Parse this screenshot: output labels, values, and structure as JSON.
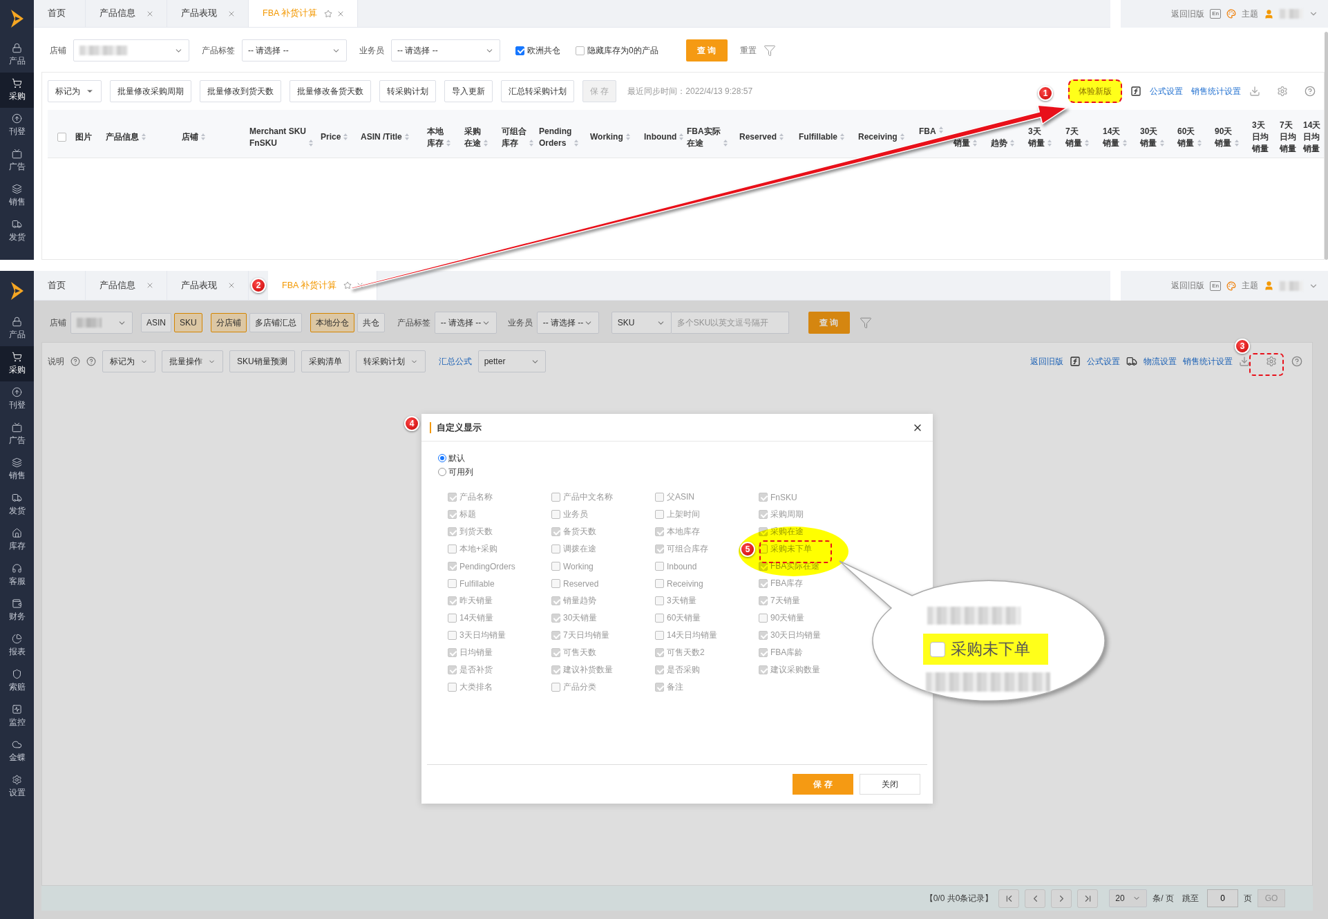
{
  "top_screen": {
    "sidebar": [
      {
        "label": "产品",
        "selected": false
      },
      {
        "label": "采购",
        "selected": true
      },
      {
        "label": "刊登",
        "selected": false
      },
      {
        "label": "广告",
        "selected": false
      },
      {
        "label": "销售",
        "selected": false
      },
      {
        "label": "发货",
        "selected": false
      }
    ],
    "tabs": [
      {
        "label": "首页",
        "closable": false,
        "star": false,
        "selected": false
      },
      {
        "label": "产品信息",
        "closable": true,
        "star": false,
        "selected": false
      },
      {
        "label": "产品表现",
        "closable": true,
        "star": false,
        "selected": false
      },
      {
        "label": "FBA 补货计算",
        "closable": true,
        "star": true,
        "selected": true
      }
    ],
    "header": {
      "old_version": "返回旧版",
      "language": "En",
      "theme": "主题"
    },
    "filters": {
      "shop_label": "店铺",
      "tag_label": "产品标签",
      "tag_value": "-- 请选择 --",
      "staff_label": "业务员",
      "staff_value": "-- 请选择 --",
      "options": [
        {
          "label": "欧洲共仓",
          "checked": true
        },
        {
          "label": "隐藏库存为0的产品",
          "checked": false
        }
      ],
      "query": "查 询",
      "reset": "重置"
    },
    "toolbar": {
      "buttons": [
        {
          "label": "标记为",
          "kind": "dropdown",
          "disabled": false
        },
        {
          "label": "批量修改采购周期",
          "kind": "button",
          "disabled": false
        },
        {
          "label": "批量修改到货天数",
          "kind": "button",
          "disabled": false
        },
        {
          "label": "批量修改备货天数",
          "kind": "button",
          "disabled": false
        },
        {
          "label": "转采购计划",
          "kind": "button",
          "disabled": false
        },
        {
          "label": "导入更新",
          "kind": "button",
          "disabled": false
        },
        {
          "label": "汇总转采购计划",
          "kind": "button",
          "disabled": false
        },
        {
          "label": "保 存",
          "kind": "button",
          "disabled": true
        }
      ],
      "sync_time": "最近同步时间：2022/4/13 9:28:57",
      "try_new": "体验新版",
      "links": [
        {
          "label": "公式设置",
          "kind": "formula"
        },
        {
          "label": "销售统计设置",
          "kind": "plain"
        }
      ]
    },
    "table": {
      "select_all": {
        "checked": false
      },
      "columns": [
        {
          "lines": [
            "图片"
          ],
          "sortable": false
        },
        {
          "lines": [
            "产品信息"
          ],
          "sortable": true
        },
        {
          "lines": [
            "店铺"
          ],
          "sortable": true
        },
        {
          "lines": [
            "Merchant SKU",
            "FnSKU"
          ],
          "sortable": true
        },
        {
          "lines": [
            "Price"
          ],
          "sortable": true
        },
        {
          "lines": [
            "ASIN /Title"
          ],
          "sortable": true
        },
        {
          "lines": [
            "本地",
            "库存"
          ],
          "sortable": true
        },
        {
          "lines": [
            "采购",
            "在途"
          ],
          "sortable": true
        },
        {
          "lines": [
            "可组合",
            "库存"
          ],
          "sortable": true
        },
        {
          "lines": [
            "Pending",
            "Orders"
          ],
          "sortable": true
        },
        {
          "lines": [
            "Working"
          ],
          "sortable": true
        },
        {
          "lines": [
            "Inbound"
          ],
          "sortable": true
        },
        {
          "lines": [
            "FBA实际",
            "在途"
          ],
          "sortable": true
        },
        {
          "lines": [
            "Reserved"
          ],
          "sortable": true
        },
        {
          "lines": [
            "Fulfillable"
          ],
          "sortable": true
        },
        {
          "lines": [
            "Receiving"
          ],
          "sortable": true
        },
        {
          "lines": [
            "FBA"
          ],
          "bottom_covered": true,
          "sortable": true
        },
        {
          "lines": [
            "销量"
          ],
          "top_covered": true,
          "sortable": true
        },
        {
          "lines": [
            "趋势"
          ],
          "top_covered": true,
          "sortable": true
        },
        {
          "lines": [
            "3天",
            "销量"
          ],
          "sortable": true
        },
        {
          "lines": [
            "7天",
            "销量"
          ],
          "sortable": true
        },
        {
          "lines": [
            "14天",
            "销量"
          ],
          "sortable": true
        },
        {
          "lines": [
            "30天",
            "销量"
          ],
          "sortable": true
        },
        {
          "lines": [
            "60天",
            "销量"
          ],
          "sortable": true
        },
        {
          "lines": [
            "90天",
            "销量"
          ],
          "sortable": true
        },
        {
          "lines": [
            "3天",
            "日均",
            "销量"
          ],
          "sortable": false
        },
        {
          "lines": [
            "7天",
            "日均",
            "销量"
          ],
          "sortable": false
        },
        {
          "lines": [
            "14天",
            "日均",
            "销量"
          ],
          "sortable": false
        }
      ]
    }
  },
  "bottom_screen": {
    "sidebar": [
      {
        "label": "产品",
        "selected": false
      },
      {
        "label": "采购",
        "selected": true
      },
      {
        "label": "刊登",
        "selected": false
      },
      {
        "label": "广告",
        "selected": false
      },
      {
        "label": "销售",
        "selected": false
      },
      {
        "label": "发货",
        "selected": false
      },
      {
        "label": "库存",
        "selected": false
      },
      {
        "label": "客服",
        "selected": false
      },
      {
        "label": "财务",
        "selected": false
      },
      {
        "label": "报表",
        "selected": false
      },
      {
        "label": "索赔",
        "selected": false
      },
      {
        "label": "监控",
        "selected": false
      },
      {
        "label": "金蝶",
        "selected": false
      },
      {
        "label": "设置",
        "selected": false
      }
    ],
    "tabs": [
      {
        "label": "首页",
        "closable": false,
        "star": false,
        "selected": false
      },
      {
        "label": "产品信息",
        "closable": true,
        "star": false,
        "selected": false
      },
      {
        "label": "产品表现",
        "closable": true,
        "star": false,
        "selected": false
      },
      {
        "label": "FBA 补货计算",
        "closable": true,
        "star": true,
        "selected": true
      }
    ],
    "header": {
      "old_version": "返回旧版",
      "language": "En",
      "theme": "主题"
    },
    "filters": {
      "shop_label": "店铺",
      "toggle_groups": [
        [
          {
            "label": "ASIN",
            "selected": false
          },
          {
            "label": "SKU",
            "selected": true
          }
        ],
        [
          {
            "label": "分店铺",
            "selected": true
          },
          {
            "label": "多店铺汇总",
            "selected": false
          }
        ],
        [
          {
            "label": "本地分仓",
            "selected": true
          },
          {
            "label": "共仓",
            "selected": false
          }
        ]
      ],
      "tag_label": "产品标签",
      "tag_value": "-- 请选择 --",
      "staff_label": "业务员",
      "staff_value": "-- 请选择 --",
      "search_type": "SKU",
      "search_placeholder": "多个SKU以英文逗号隔开",
      "query": "查 询"
    },
    "toolbar": {
      "help_label": "说明",
      "buttons": [
        {
          "label": "标记为",
          "kind": "dropdown"
        },
        {
          "label": "批量操作",
          "kind": "dropdown"
        },
        {
          "label": "SKU销量预测",
          "kind": "button"
        },
        {
          "label": "采购清单",
          "kind": "button"
        },
        {
          "label": "转采购计划",
          "kind": "dropdown"
        }
      ],
      "formula_label": "汇总公式",
      "formula_value": "petter",
      "links": [
        {
          "label": "返回旧版",
          "kind": "plain"
        },
        {
          "label": "公式设置",
          "kind": "formula"
        },
        {
          "label": "物流设置",
          "kind": "truck"
        },
        {
          "label": "销售统计设置",
          "kind": "plain"
        }
      ]
    },
    "dialog": {
      "title": "自定义显示",
      "modes": [
        {
          "label": "默认",
          "selected": true
        },
        {
          "label": "可用列",
          "selected": false
        }
      ],
      "options_disabled": true,
      "columns": [
        {
          "label": "产品名称",
          "checked": true
        },
        {
          "label": "产品中文名称",
          "checked": false
        },
        {
          "label": "父ASIN",
          "checked": false
        },
        {
          "label": "FnSKU",
          "checked": true
        },
        {
          "label": "标题",
          "checked": true
        },
        {
          "label": "业务员",
          "checked": false
        },
        {
          "label": "上架时间",
          "checked": false
        },
        {
          "label": "采购周期",
          "checked": true
        },
        {
          "label": "到货天数",
          "checked": true
        },
        {
          "label": "备货天数",
          "checked": true
        },
        {
          "label": "本地库存",
          "checked": true
        },
        {
          "label": "采购在途",
          "checked": true
        },
        {
          "label": "本地+采购",
          "checked": false
        },
        {
          "label": "调拨在途",
          "checked": false
        },
        {
          "label": "可组合库存",
          "checked": true
        },
        {
          "label": "采购未下单",
          "checked": false
        },
        {
          "label": "PendingOrders",
          "checked": true
        },
        {
          "label": "Working",
          "checked": false
        },
        {
          "label": "Inbound",
          "checked": false
        },
        {
          "label": "FBA实际在途",
          "checked": true
        },
        {
          "label": "Fulfillable",
          "checked": false
        },
        {
          "label": "Reserved",
          "checked": false
        },
        {
          "label": "Receiving",
          "checked": false
        },
        {
          "label": "FBA库存",
          "checked": true
        },
        {
          "label": "昨天销量",
          "checked": true
        },
        {
          "label": "销量趋势",
          "checked": true
        },
        {
          "label": "3天销量",
          "checked": false
        },
        {
          "label": "7天销量",
          "checked": true
        },
        {
          "label": "14天销量",
          "checked": false
        },
        {
          "label": "30天销量",
          "checked": true
        },
        {
          "label": "60天销量",
          "checked": false
        },
        {
          "label": "90天销量",
          "checked": false
        },
        {
          "label": "3天日均销量",
          "checked": false
        },
        {
          "label": "7天日均销量",
          "checked": true
        },
        {
          "label": "14天日均销量",
          "checked": false
        },
        {
          "label": "30天日均销量",
          "checked": true
        },
        {
          "label": "日均销量",
          "checked": true
        },
        {
          "label": "可售天数",
          "checked": true
        },
        {
          "label": "可售天数2",
          "checked": true
        },
        {
          "label": "FBA库龄",
          "checked": true
        },
        {
          "label": "是否补货",
          "checked": true
        },
        {
          "label": "建议补货数量",
          "checked": true
        },
        {
          "label": "是否采购",
          "checked": true
        },
        {
          "label": "建议采购数量",
          "checked": true
        },
        {
          "label": "大类排名",
          "checked": false
        },
        {
          "label": "产品分类",
          "checked": false
        },
        {
          "label": "备注",
          "checked": true
        }
      ],
      "save": "保 存",
      "close": "关闭"
    },
    "pager": {
      "summary": "【0/0  共0条记录】",
      "page_size": "20",
      "per_page": "条/ 页",
      "jump_label": "跳至",
      "page_value": "0",
      "page_unit": "页",
      "go": "GO"
    }
  },
  "annotations": [
    {
      "label": "1"
    },
    {
      "label": "2"
    },
    {
      "label": "3"
    },
    {
      "label": "4"
    },
    {
      "label": "5"
    }
  ],
  "callout": {
    "label": "采购未下单",
    "checked": false
  }
}
